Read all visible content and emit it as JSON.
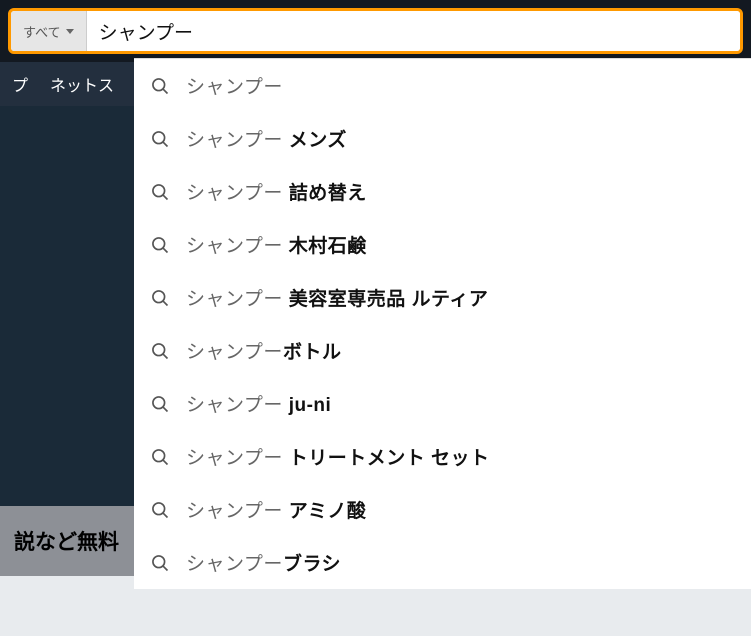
{
  "search": {
    "category_label": "すべて",
    "input_value": "シャンプー",
    "placeholder": ""
  },
  "nav": {
    "item1_fragment": "プ",
    "item2_fragment": "ネットス"
  },
  "promo": {
    "text_fragment": "説など無料"
  },
  "suggestions": [
    {
      "base": "シャンプー",
      "bold": ""
    },
    {
      "base": "シャンプー ",
      "bold": "メンズ"
    },
    {
      "base": "シャンプー ",
      "bold": "詰め替え"
    },
    {
      "base": "シャンプー ",
      "bold": "木村石鹸"
    },
    {
      "base": "シャンプー ",
      "bold": "美容室専売品 ルティア"
    },
    {
      "base": "シャンプー",
      "bold": "ボトル"
    },
    {
      "base": "シャンプー ",
      "bold": "ju-ni"
    },
    {
      "base": "シャンプー ",
      "bold": "トリートメント セット"
    },
    {
      "base": "シャンプー ",
      "bold": "アミノ酸"
    },
    {
      "base": "シャンプー",
      "bold": "ブラシ"
    }
  ]
}
